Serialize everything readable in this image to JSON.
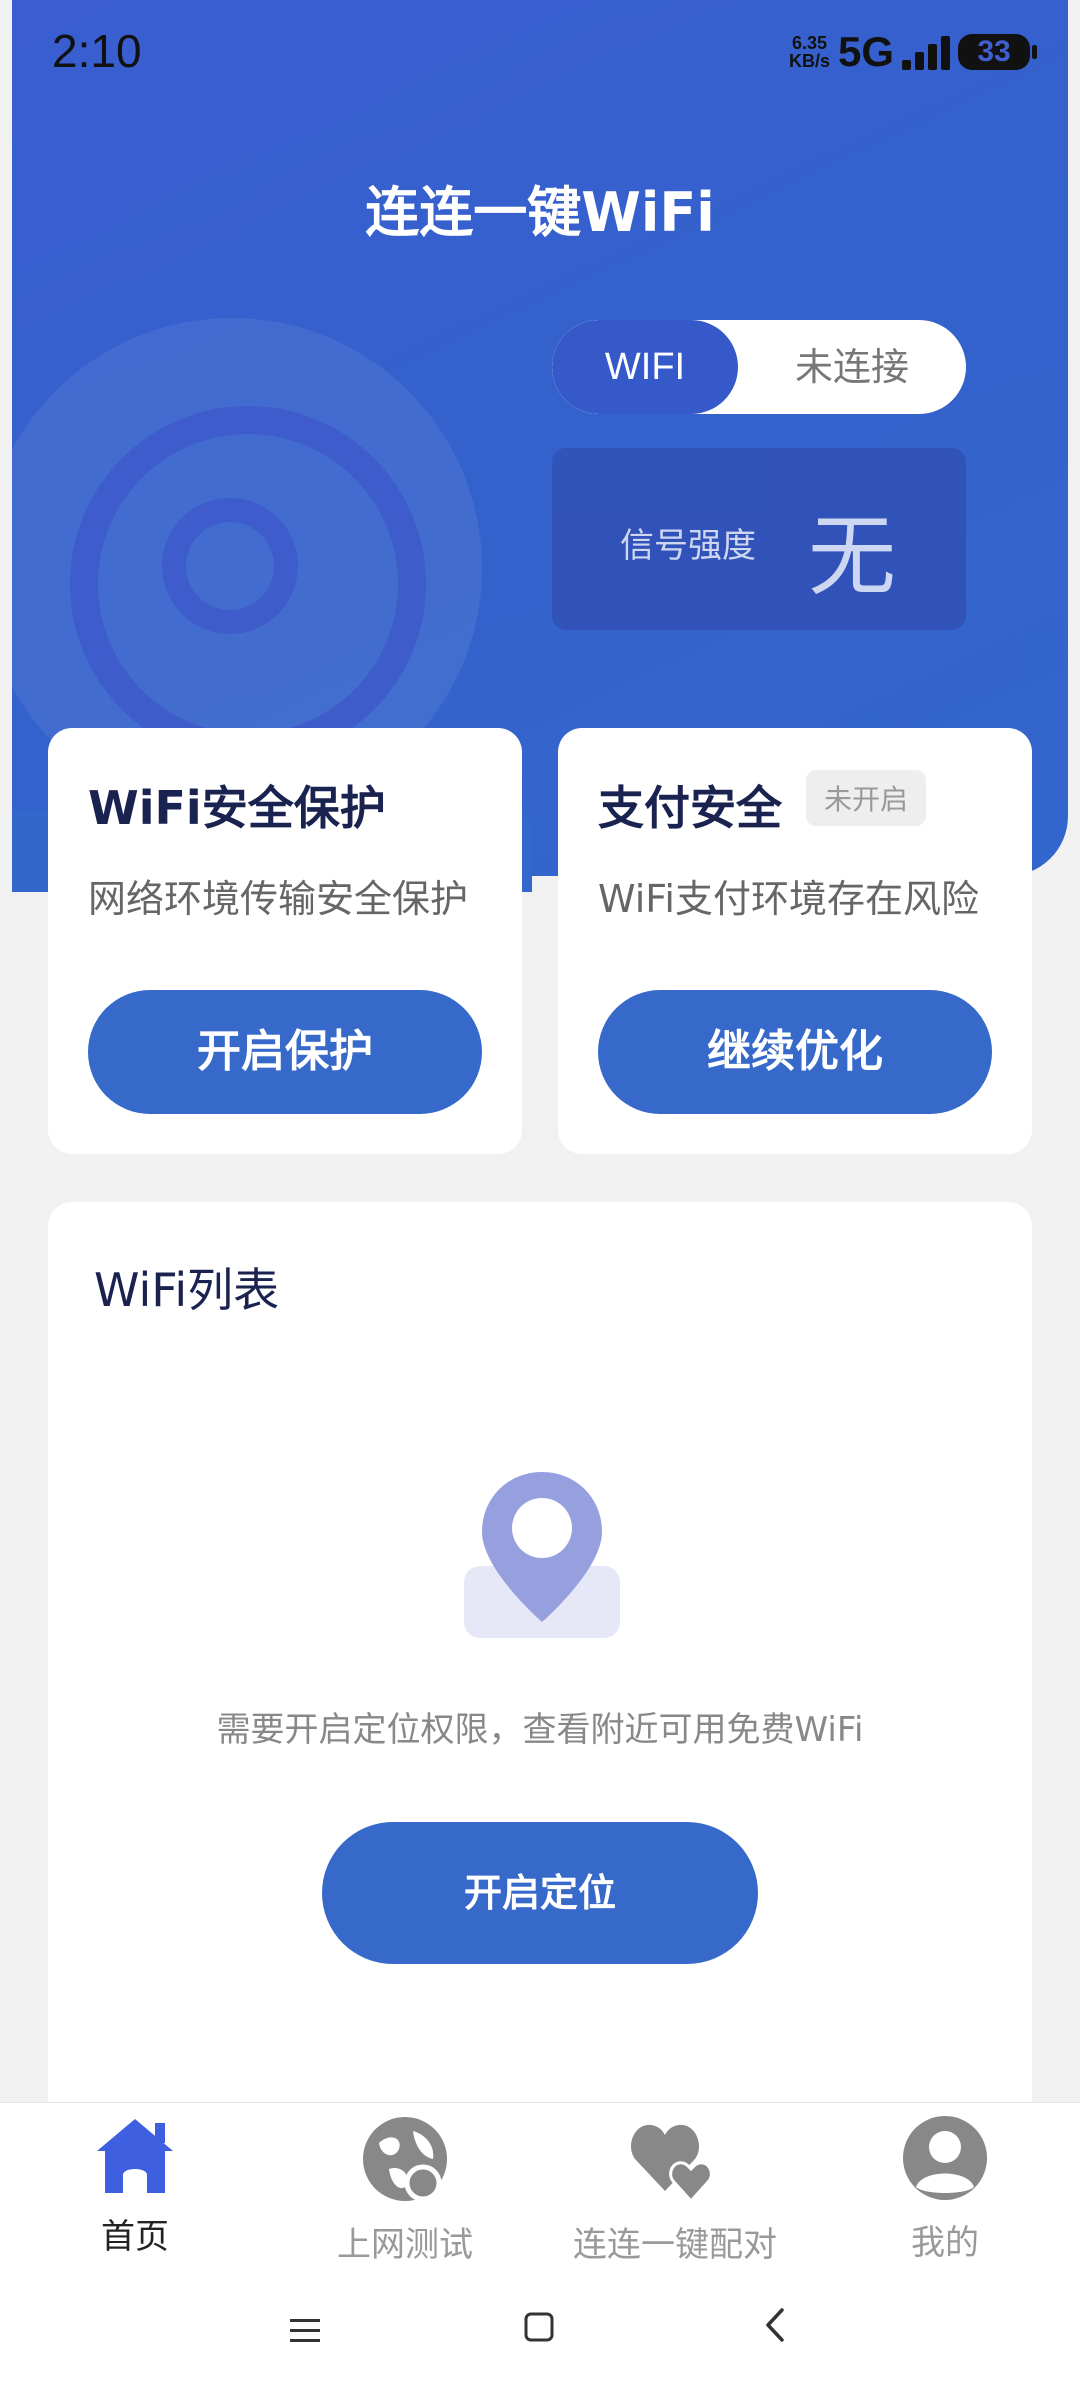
{
  "status_bar": {
    "time": "2:10",
    "speed_top": "6.35",
    "speed_bottom": "KB/s",
    "network": "5G",
    "battery": "33"
  },
  "header": {
    "title": "连连一键WiFi"
  },
  "connection": {
    "toggle_left": "WIFI",
    "toggle_right": "未连接",
    "signal_label": "信号强度",
    "signal_value": "无"
  },
  "cards": {
    "protection": {
      "title": "WiFi安全保护",
      "desc": "网络环境传输安全保护",
      "button": "开启保护"
    },
    "payment": {
      "title": "支付安全",
      "badge": "未开启",
      "desc": "WiFi支付环境存在风险",
      "button": "继续优化"
    }
  },
  "wifi_list": {
    "title": "WiFi列表",
    "message": "需要开启定位权限，查看附近可用免费WiFi",
    "button": "开启定位"
  },
  "bottom_nav": {
    "items": [
      {
        "label": "首页",
        "icon": "home-icon",
        "active": true
      },
      {
        "label": "上网测试",
        "icon": "globe-icon",
        "active": false
      },
      {
        "label": "连连一键配对",
        "icon": "hearts-icon",
        "active": false
      },
      {
        "label": "我的",
        "icon": "user-icon",
        "active": false
      }
    ]
  },
  "colors": {
    "primary": "#3669c9",
    "hero": "#3a5ed1",
    "title_text": "#1a2250"
  }
}
